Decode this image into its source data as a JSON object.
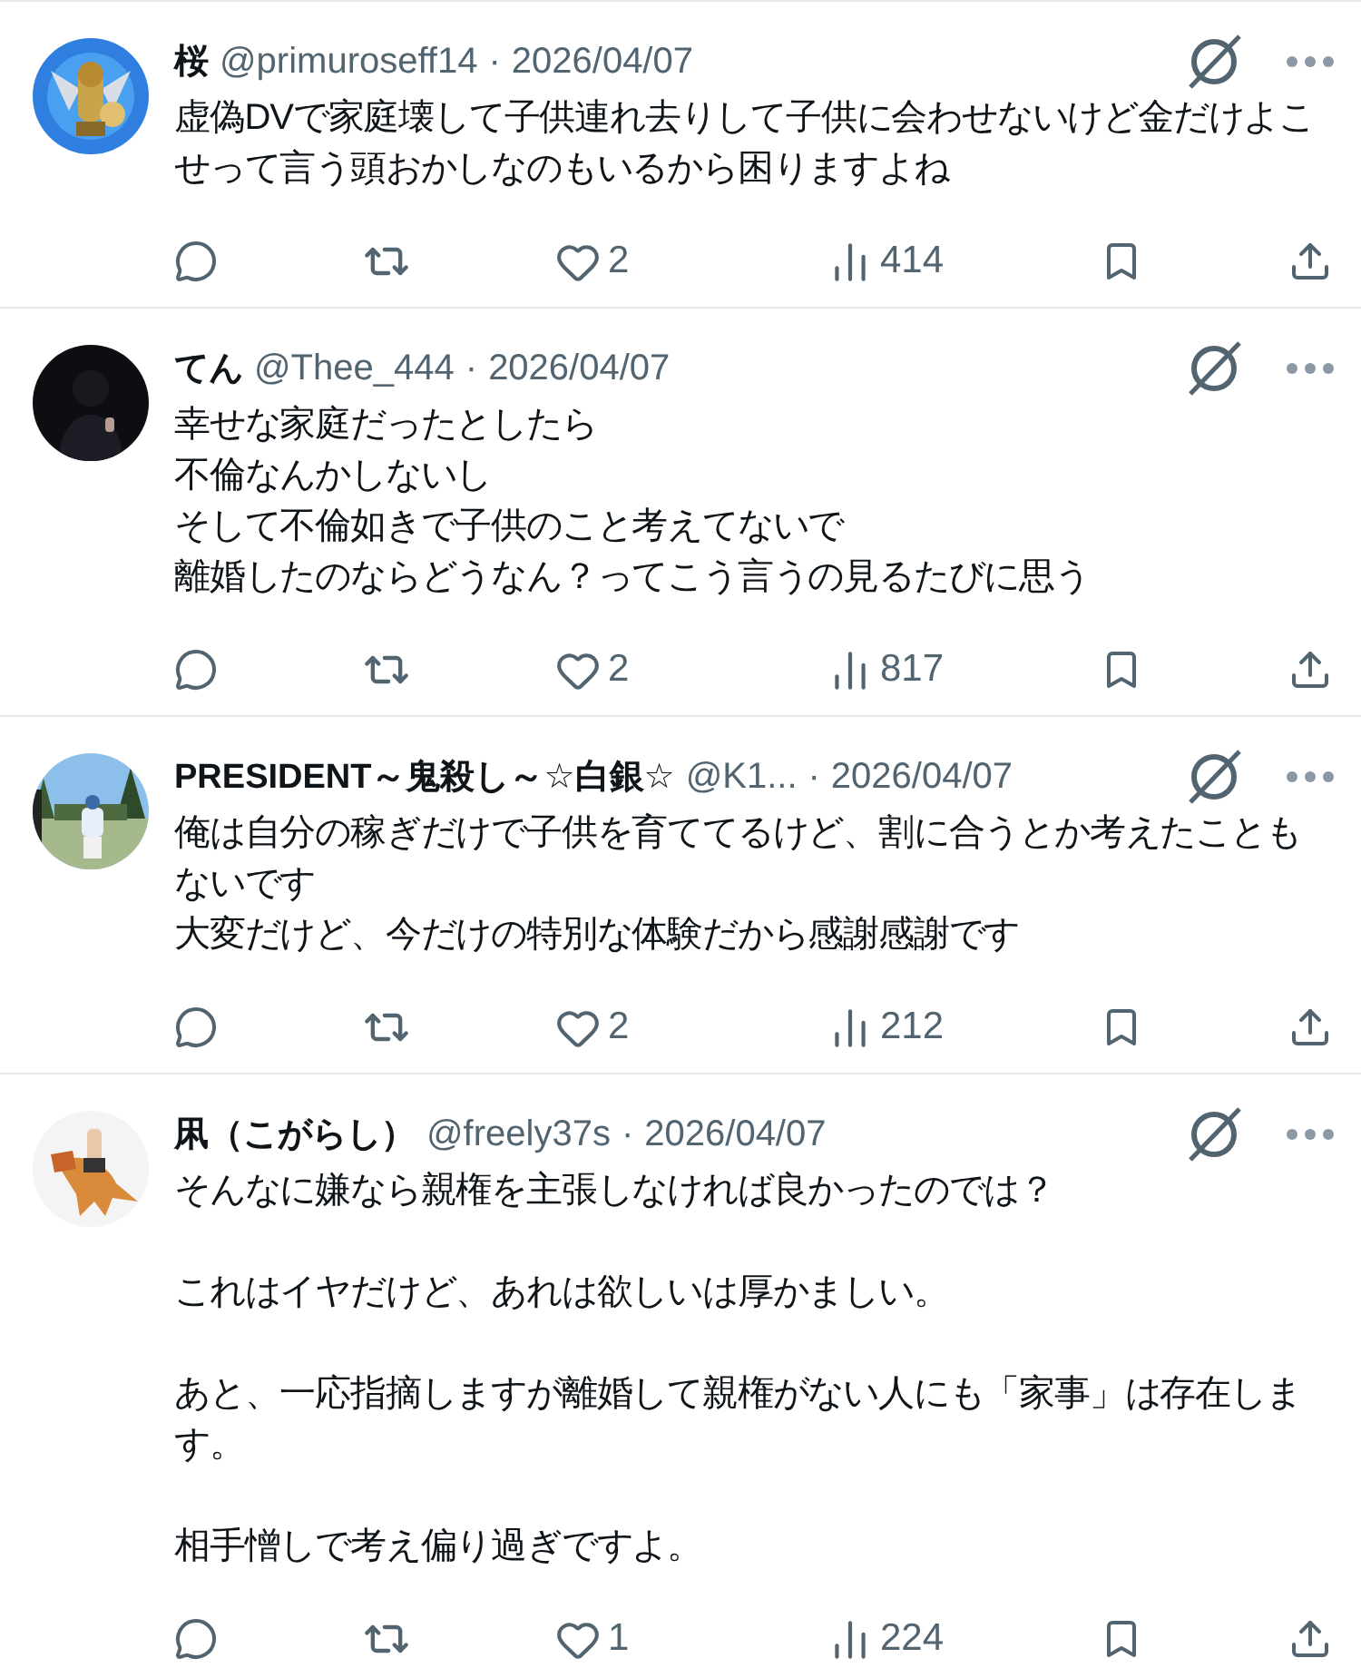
{
  "tweets": [
    {
      "name": "桜",
      "handle": "@primuroseff14",
      "separator": "·",
      "date": "2026/04/07",
      "paragraphs": [
        [
          "虚偽DVで家庭壊して子供連れ去りして子供に会わせないけど金だけよこせって言う頭おかしなのもいるから困りますよね"
        ]
      ],
      "likes": "2",
      "views": "414"
    },
    {
      "name": "てん",
      "handle": "@Thee_444",
      "separator": "·",
      "date": "2026/04/07",
      "paragraphs": [
        [
          "幸せな家庭だったとしたら",
          "不倫なんかしないし",
          "そして不倫如きで子供のこと考えてないで",
          "離婚したのならどうなん？ってこう言うの見るたびに思う"
        ]
      ],
      "likes": "2",
      "views": "817"
    },
    {
      "name": "PRESIDENT～鬼殺し～☆白銀☆",
      "handle": "@K1...",
      "separator": "·",
      "date": "2026/04/07",
      "paragraphs": [
        [
          "俺は自分の稼ぎだけで子供を育ててるけど、割に合うとか考えたこともないです",
          "大変だけど、今だけの特別な体験だから感謝感謝です"
        ]
      ],
      "likes": "2",
      "views": "212"
    },
    {
      "name": "凩（こがらし）",
      "handle": "@freely37s",
      "separator": "·",
      "date": "2026/04/07",
      "paragraphs": [
        [
          "そんなに嫌なら親権を主張しなければ良かったのでは？"
        ],
        [
          "これはイヤだけど、あれは欲しいは厚かましい。"
        ],
        [
          "あと、一応指摘しますが離婚して親権がない人にも「家事」は存在します。"
        ],
        [
          "相手憎しで考え偏り過ぎですよ。"
        ]
      ],
      "likes": "1",
      "views": "224"
    }
  ]
}
